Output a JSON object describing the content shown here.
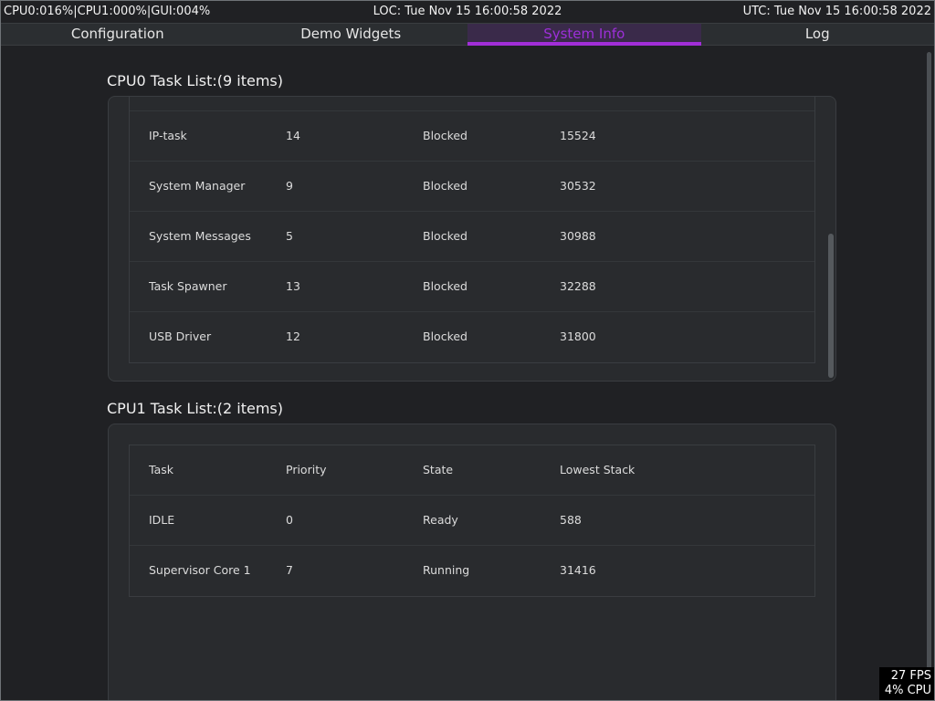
{
  "status_bar": {
    "cpu_usage": "CPU0:016%|CPU1:000%|GUI:004%",
    "local_time": "LOC: Tue Nov 15 16:00:58 2022",
    "utc_time": "UTC: Tue Nov 15 16:00:58 2022"
  },
  "tabs": [
    {
      "label": "Configuration",
      "active": false
    },
    {
      "label": "Demo Widgets",
      "active": false
    },
    {
      "label": "System Info",
      "active": true
    },
    {
      "label": "Log",
      "active": false
    }
  ],
  "colors": {
    "accent": "#a22ed8",
    "background": "#202124",
    "panel": "#292b2e"
  },
  "cpu0": {
    "title": "CPU0 Task List:(9 items)",
    "rows": [
      [
        "IP-task",
        "14",
        "Blocked",
        "15524"
      ],
      [
        "System Manager",
        "9",
        "Blocked",
        "30532"
      ],
      [
        "System Messages",
        "5",
        "Blocked",
        "30988"
      ],
      [
        "Task Spawner",
        "13",
        "Blocked",
        "32288"
      ],
      [
        "USB Driver",
        "12",
        "Blocked",
        "31800"
      ]
    ]
  },
  "cpu1": {
    "title": "CPU1 Task List:(2 items)",
    "header": [
      "Task",
      "Priority",
      "State",
      "Lowest Stack"
    ],
    "rows": [
      [
        "IDLE",
        "0",
        "Ready",
        "588"
      ],
      [
        "Supervisor Core 1",
        "7",
        "Running",
        "31416"
      ]
    ]
  },
  "perf_overlay": {
    "fps": "27 FPS",
    "cpu": "4% CPU"
  }
}
